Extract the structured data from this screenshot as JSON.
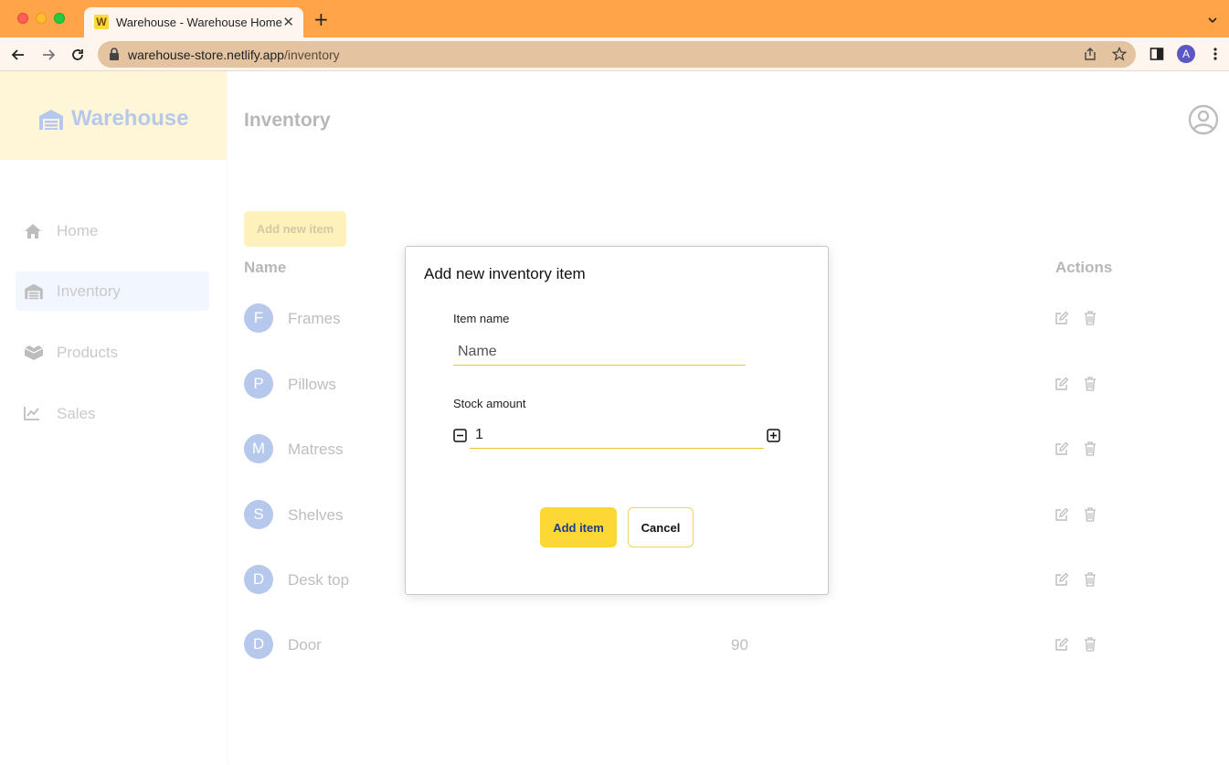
{
  "browser": {
    "tab_title": "Warehouse - Warehouse Home",
    "favicon_letter": "W",
    "url_host": "warehouse-store.netlify.app",
    "url_path": "/inventory",
    "profile_initial": "A"
  },
  "sidebar": {
    "brand": "Warehouse",
    "items": [
      {
        "label": "Home",
        "icon": "home-icon"
      },
      {
        "label": "Inventory",
        "icon": "warehouse-icon",
        "active": true
      },
      {
        "label": "Products",
        "icon": "boxes-icon"
      },
      {
        "label": "Sales",
        "icon": "chart-line-icon"
      }
    ]
  },
  "main": {
    "title": "Inventory",
    "add_button": "Add new item",
    "columns": {
      "name": "Name",
      "actions": "Actions"
    },
    "rows": [
      {
        "initial": "F",
        "name": "Frames",
        "stock": ""
      },
      {
        "initial": "P",
        "name": "Pillows",
        "stock": ""
      },
      {
        "initial": "M",
        "name": "Matress",
        "stock": ""
      },
      {
        "initial": "S",
        "name": "Shelves",
        "stock": ""
      },
      {
        "initial": "D",
        "name": "Desk top",
        "stock": ""
      },
      {
        "initial": "D",
        "name": "Door",
        "stock": "90"
      }
    ]
  },
  "modal": {
    "title": "Add new inventory item",
    "item_name_label": "Item name",
    "item_name_placeholder": "Name",
    "stock_label": "Stock amount",
    "stock_value": "1",
    "add_button": "Add item",
    "cancel_button": "Cancel"
  },
  "colors": {
    "tabbar": "#ffa448",
    "brand_bg": "#ffe68c",
    "accent_yellow": "#fdd835",
    "accent_blue": "#2f63c6"
  }
}
